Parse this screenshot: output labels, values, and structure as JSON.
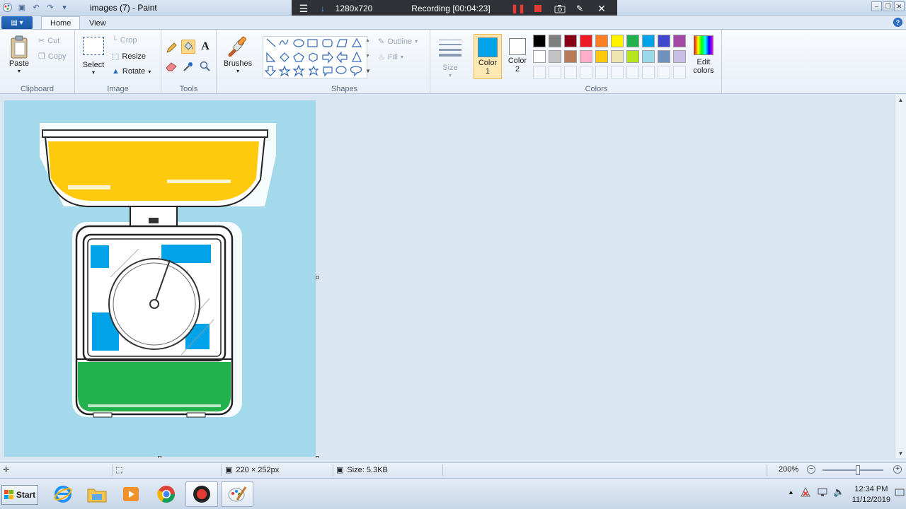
{
  "window": {
    "title": "images (7) - Paint"
  },
  "recorder": {
    "resolution": "1280x720",
    "status": "Recording [00:04:23]"
  },
  "tabs": [
    {
      "label": "Home"
    },
    {
      "label": "View"
    }
  ],
  "clipboard": {
    "paste": "Paste",
    "cut": "Cut",
    "copy": "Copy",
    "group": "Clipboard"
  },
  "image": {
    "select": "Select",
    "crop": "Crop",
    "resize": "Resize",
    "rotate": "Rotate",
    "group": "Image"
  },
  "tools": {
    "group": "Tools",
    "text_glyph": "A"
  },
  "brushes": {
    "label": "Brushes"
  },
  "shapes": {
    "outline": "Outline",
    "fill": "Fill",
    "group": "Shapes"
  },
  "size": {
    "label": "Size"
  },
  "colors": {
    "color1_line1": "Color",
    "color1_line2": "1",
    "color2_line1": "Color",
    "color2_line2": "2",
    "edit_line1": "Edit",
    "edit_line2": "colors",
    "group": "Colors",
    "color1_value": "#00a2e8",
    "color2_value": "#ffffff",
    "palette_row1": [
      "#000000",
      "#7f7f7f",
      "#880015",
      "#ed1c24",
      "#ff7f27",
      "#fff200",
      "#22b14c",
      "#00a2e8",
      "#3f48cc",
      "#a349a4"
    ],
    "palette_row2": [
      "#ffffff",
      "#c3c3c3",
      "#b97a57",
      "#ffaec9",
      "#ffc90e",
      "#efe4b0",
      "#b5e61d",
      "#99d9ea",
      "#7092be",
      "#c8bfe7"
    ]
  },
  "statusbar": {
    "dimensions": "220 × 252px",
    "size": "Size: 5.3KB",
    "zoom": "200%"
  },
  "taskbar": {
    "start": "Start",
    "time": "12:34 PM",
    "date": "11/12/2019"
  }
}
